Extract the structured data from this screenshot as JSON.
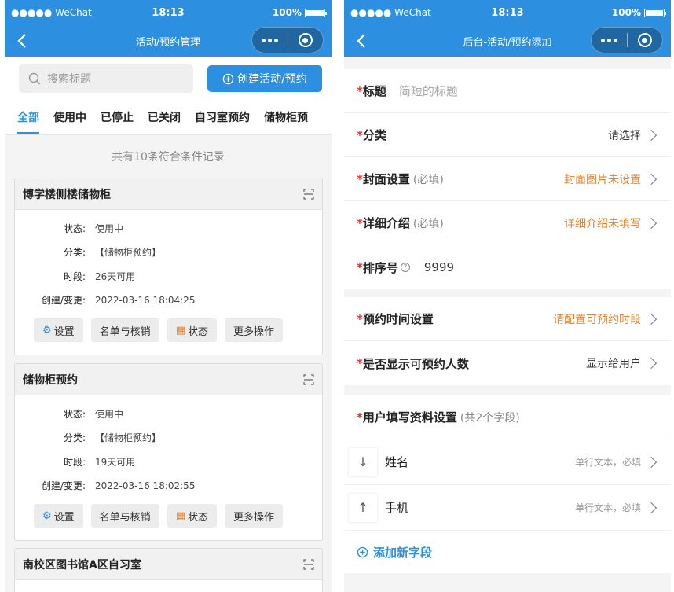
{
  "status_bar": {
    "carrier": "●●●●● WeChat",
    "time": "18:13",
    "battery": "100%"
  },
  "left": {
    "nav_title": "活动/预约管理",
    "search_placeholder": "搜索标题",
    "create_button": "创建活动/预约",
    "tabs": [
      "全部",
      "使用中",
      "已停止",
      "已关闭",
      "自习室预约",
      "储物柜预"
    ],
    "count_text": "共有10条符合条件记录",
    "labels": {
      "status": "状态:",
      "category": "分类:",
      "period": "时段:",
      "created": "创建/变更:"
    },
    "action_labels": {
      "settings": "设置",
      "roster": "名单与核销",
      "state": "状态",
      "more": "更多操作"
    },
    "cards": [
      {
        "title": "博学楼侧楼储物柜",
        "status": "使用中",
        "category": "【储物柜预约】",
        "period": "26天可用",
        "created": "2022-03-16 18:04:25"
      },
      {
        "title": "储物柜预约",
        "status": "使用中",
        "category": "【储物柜预约】",
        "period": "19天可用",
        "created": "2022-03-16 18:02:55"
      },
      {
        "title": "南校区图书馆A区自习室"
      }
    ]
  },
  "right": {
    "nav_title": "后台-活动/预约添加",
    "required_mark": "*",
    "title_field": {
      "label": "标题",
      "placeholder": "简短的标题"
    },
    "category_field": {
      "label": "分类",
      "value": "请选择"
    },
    "cover_field": {
      "label": "封面设置",
      "hint": "(必填)",
      "value": "封面图片未设置"
    },
    "detail_field": {
      "label": "详细介绍",
      "hint": "(必填)",
      "value": "详细介绍未填写"
    },
    "order_field": {
      "label": "排序号",
      "value": "9999"
    },
    "time_field": {
      "label": "预约时间设置",
      "value": "请配置可预约时段"
    },
    "show_count_field": {
      "label": "是否显示可预约人数",
      "value": "显示给用户"
    },
    "user_fields": {
      "label": "用户填写资料设置",
      "hint": "(共2个字段)",
      "items": [
        {
          "arrow": "↓",
          "name": "姓名",
          "meta": "单行文本，必填"
        },
        {
          "arrow": "↑",
          "name": "手机",
          "meta": "单行文本，必填"
        }
      ],
      "add_label": "添加新字段"
    }
  },
  "colors": {
    "primary": "#2d8fe0",
    "warning": "#e8822e",
    "required": "#e03030"
  }
}
